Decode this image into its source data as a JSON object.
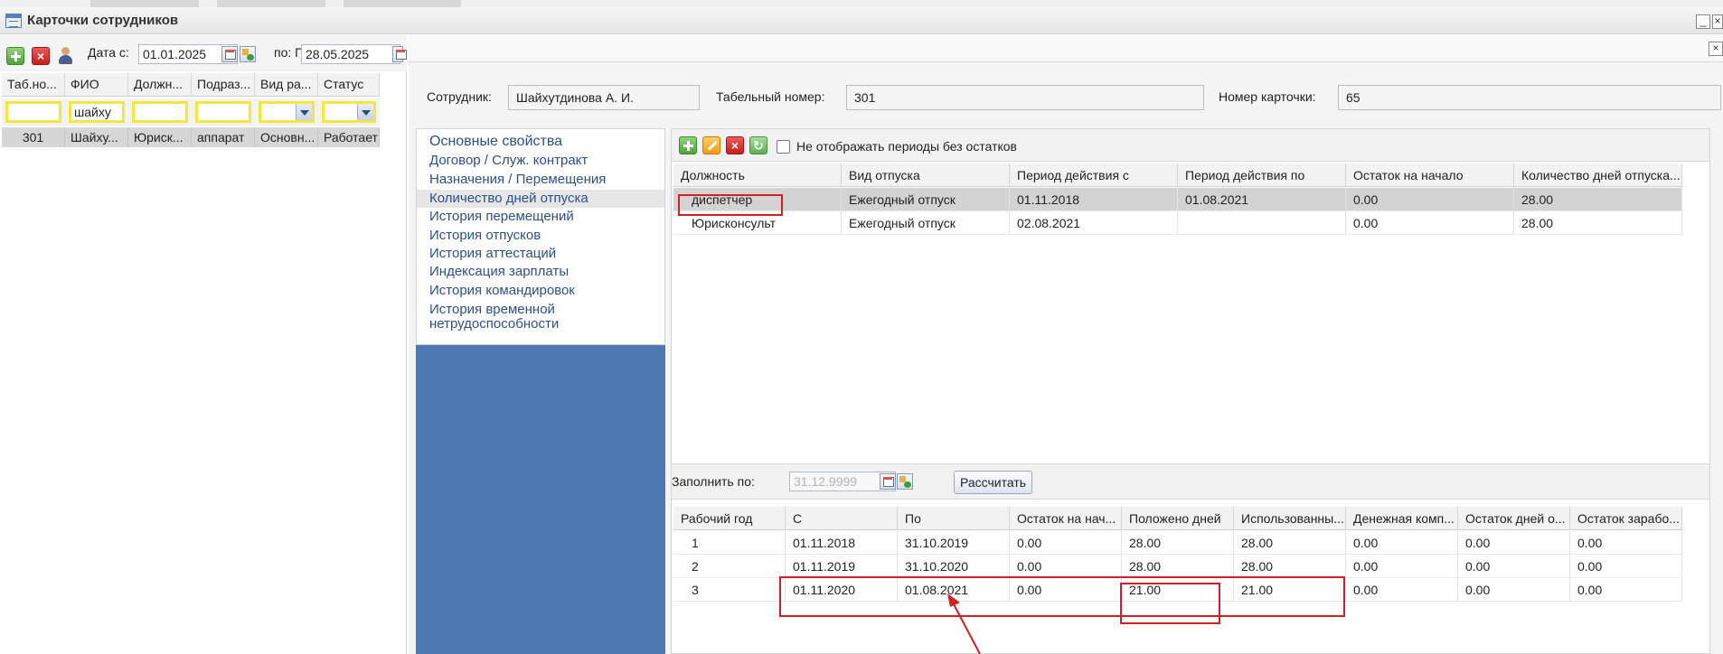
{
  "window": {
    "title": "Карточки сотрудников",
    "min_glyph": "_",
    "close_glyph": "×"
  },
  "left": {
    "toolbar": {
      "add_icon": "add-icon",
      "delete_icon": "delete-icon",
      "user_icon": "user-icon",
      "date_from_label": "Дата с:",
      "date_from": "01.01.2025",
      "date_to_label": "по: П",
      "date_to": "28.05.2025"
    },
    "columns": [
      "Таб.но...",
      "ФИО",
      "Должн...",
      "Подраз...",
      "Вид ра...",
      "Статус"
    ],
    "filters": [
      "",
      "шайху",
      "",
      "",
      "",
      ""
    ],
    "rows": [
      [
        "301",
        "Шайху...",
        "Юриск...",
        "аппарат",
        "Основн...",
        "Работает"
      ]
    ]
  },
  "right": {
    "close_glyph": "×",
    "employee_label": "Сотрудник:",
    "employee": "Шайхутдинова А. И.",
    "tab_number_label": "Табельный номер:",
    "tab_number": "301",
    "card_number_label": "Номер карточки:",
    "card_number": "65",
    "nav": [
      "Основные свойства",
      "Договор / Служ. контракт",
      "Назначения / Перемещения",
      "Количество дней отпуска",
      "История перемещений",
      "История отпусков",
      "История аттестаций",
      "Индексация зарплаты",
      "История командировок",
      "История временной",
      "нетрудоспособности"
    ],
    "active_nav_index": 3,
    "upper_grid": {
      "hide_checkbox_label": "Не отображать периоды без остатков",
      "columns": [
        "Должность",
        "Вид отпуска",
        "Период действия с",
        "Период действия по",
        "Остаток на начало",
        "Количество дней отпуска..."
      ],
      "rows": [
        [
          "диспетчер",
          "Ежегодный отпуск",
          "01.11.2018",
          "01.08.2021",
          "0.00",
          "28.00"
        ],
        [
          "Юрисконсульт",
          "Ежегодный отпуск",
          "02.08.2021",
          "",
          "0.00",
          "28.00"
        ]
      ]
    },
    "fill": {
      "label": "Заполнить по:",
      "date": "31.12.9999",
      "calc_button": "Рассчитать"
    },
    "lower_grid": {
      "columns": [
        "Рабочий год",
        "С",
        "По",
        "Остаток на нач...",
        "Положено дней",
        "Использованны...",
        "Денежная комп...",
        "Остаток дней о...",
        "Остаток зарабо..."
      ],
      "rows": [
        [
          "1",
          "01.11.2018",
          "31.10.2019",
          "0.00",
          "28.00",
          "28.00",
          "0.00",
          "0.00",
          "0.00"
        ],
        [
          "2",
          "01.11.2019",
          "31.10.2020",
          "0.00",
          "28.00",
          "28.00",
          "0.00",
          "0.00",
          "0.00"
        ],
        [
          "3",
          "01.11.2020",
          "01.08.2021",
          "0.00",
          "21.00",
          "21.00",
          "0.00",
          "0.00",
          "0.00"
        ]
      ]
    }
  },
  "colors": {
    "accent_blue": "#4d78b0",
    "link_blue": "#2d4f8b",
    "highlight_red": "#d11f25",
    "filter_yellow": "#f3e63c"
  }
}
